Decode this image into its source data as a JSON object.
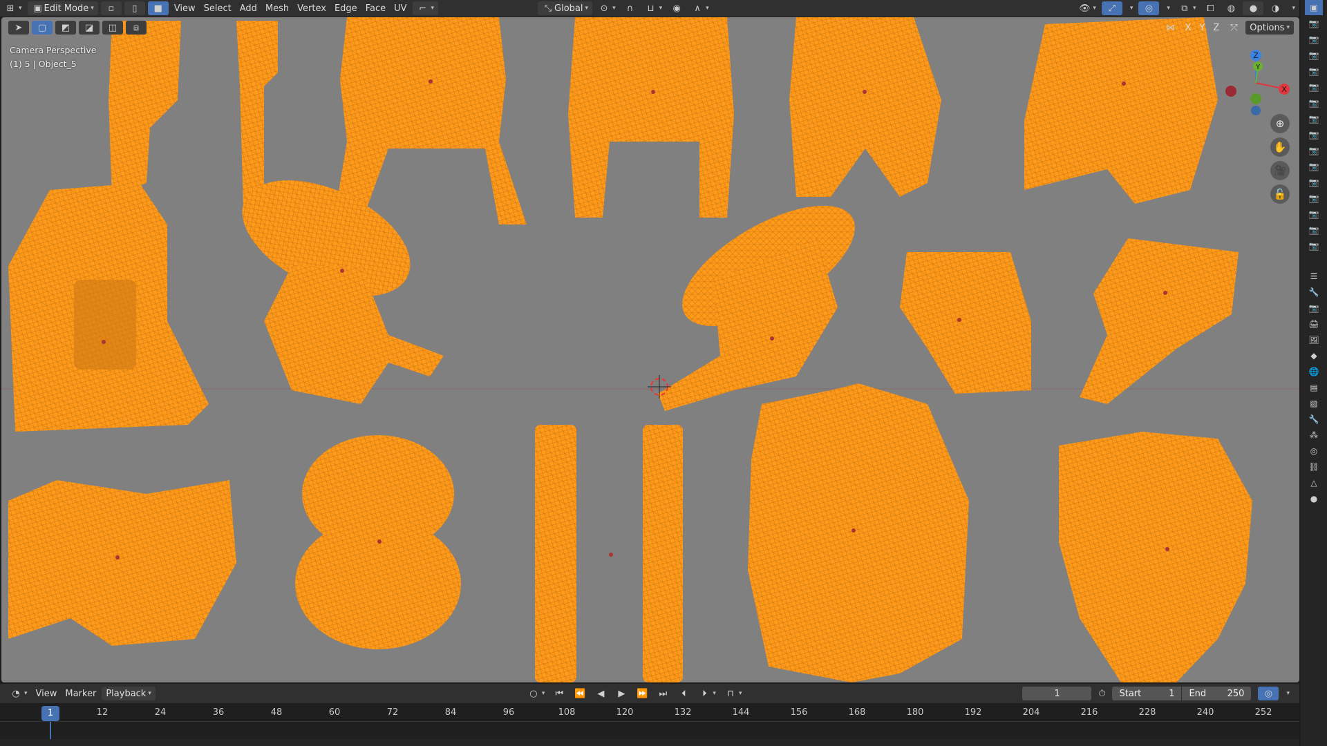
{
  "topbar": {
    "mode_label": "Edit Mode",
    "menus": [
      "View",
      "Select",
      "Add",
      "Mesh",
      "Vertex",
      "Edge",
      "Face",
      "UV"
    ],
    "orientation_label": "Global"
  },
  "viewport": {
    "header_options_label": "Options",
    "axis_labels": [
      "X",
      "Y",
      "Z"
    ],
    "overlay_line1": "Camera Perspective",
    "overlay_line2": "(1) 5 | Object_5",
    "gizmo_axes": {
      "x": "X",
      "y": "Y",
      "z": "Z"
    },
    "colors": {
      "background": "#808080",
      "wireframe": "#ff9a1a",
      "x_axis": "#e0383e",
      "y_axis": "#6bb033",
      "z_axis": "#3a82e6"
    }
  },
  "timeline": {
    "menus": [
      "View",
      "Marker",
      "Playback"
    ],
    "current_frame": "1",
    "start_label": "Start",
    "start_value": "1",
    "end_label": "End",
    "end_value": "250",
    "playhead_frame": "1",
    "ticks": [
      "12",
      "24",
      "36",
      "48",
      "60",
      "72",
      "84",
      "96",
      "108",
      "120",
      "132",
      "144",
      "156",
      "168",
      "180",
      "192",
      "204",
      "216",
      "228",
      "240",
      "252"
    ]
  }
}
